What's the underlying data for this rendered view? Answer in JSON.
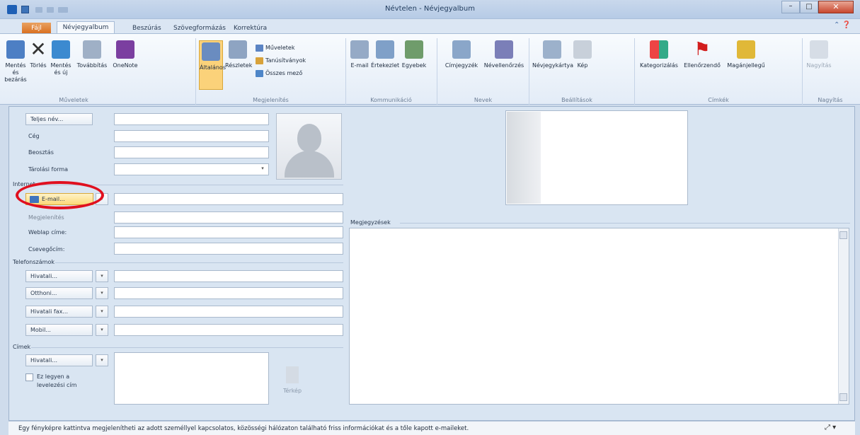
{
  "window": {
    "title": "Névtelen - Névjegyalbum"
  },
  "tabs": {
    "file": "Fájl",
    "items": [
      "Névjegyalbum",
      "Beszúrás",
      "Szövegformázás",
      "Korrektúra"
    ]
  },
  "ribbon": {
    "actions": {
      "save_close": "Mentés és bezárás",
      "delete": "Törlés",
      "save_new": "Mentés és új",
      "forward": "Továbbítás",
      "onenote": "OneNote",
      "label": "Műveletek"
    },
    "show": {
      "general": "Általános",
      "details": "Részletek",
      "activities": "Műveletek",
      "certificates": "Tanúsítványok",
      "all_fields": "Összes mező",
      "label": "Megjelenítés"
    },
    "communicate": {
      "email": "E-mail",
      "meeting": "Értekezlet",
      "more": "Egyebek",
      "label": "Kommunikáció"
    },
    "names": {
      "address_book": "Címjegyzék",
      "check_names": "Névellenőrzés",
      "label": "Nevek"
    },
    "options": {
      "business_card": "Névjegykártya",
      "picture": "Kép",
      "label": "Beállítások"
    },
    "tags": {
      "categorize": "Kategorizálás",
      "follow_up": "Ellenőrzendő",
      "private": "Magánjellegű",
      "label": "Címkék"
    },
    "zoom": {
      "zoom": "Nagyítás",
      "label": "Nagyítás"
    }
  },
  "form": {
    "full_name": "Teljes név...",
    "company": "Cég",
    "job_title": "Beosztás",
    "file_as": "Tárolási forma",
    "internet": "Internet",
    "email": "E-mail...",
    "display_as": "Megjelenítés",
    "webpage": "Weblap címe:",
    "im": "Csevegőcím:",
    "phones": "Telefonszámok",
    "phone_rows": [
      "Hivatali...",
      "Otthoni...",
      "Hivatali fax...",
      "Mobil..."
    ],
    "addresses": "Címek",
    "address_type": "Hivatali...",
    "mailing_line1": "Ez legyen a",
    "mailing_line2": "levelezési cím",
    "map": "Térkép",
    "notes": "Megjegyzések"
  },
  "people_pane": {
    "text": "Egy fényképre kattintva megjelenítheti az adott személlyel kapcsolatos, közösségi hálózaton található friss információkat és a tőle kapott e-maileket."
  }
}
